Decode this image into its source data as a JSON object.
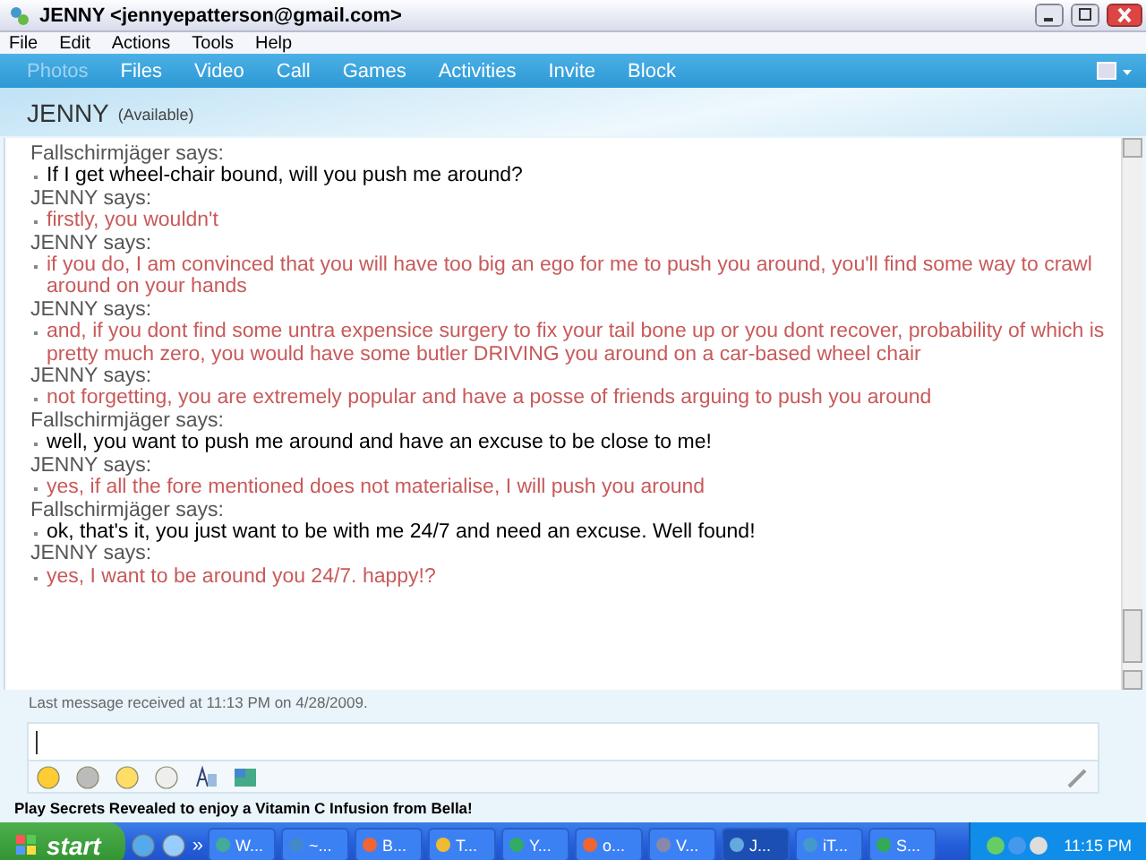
{
  "window": {
    "title": "JENNY <jennyepatterson@gmail.com>"
  },
  "menu": [
    "File",
    "Edit",
    "Actions",
    "Tools",
    "Help"
  ],
  "toolbar": [
    {
      "label": "Photos",
      "disabled": true
    },
    {
      "label": "Files",
      "disabled": false
    },
    {
      "label": "Video",
      "disabled": false
    },
    {
      "label": "Call",
      "disabled": false
    },
    {
      "label": "Games",
      "disabled": false
    },
    {
      "label": "Activities",
      "disabled": false
    },
    {
      "label": "Invite",
      "disabled": false
    },
    {
      "label": "Block",
      "disabled": false
    }
  ],
  "contact": {
    "name": "JENNY",
    "status": "(Available)"
  },
  "messages": [
    {
      "sender": "Fallschirmjäger says:",
      "text": "If I get wheel-chair bound, will you push me around?",
      "color": "#000000"
    },
    {
      "sender": "JENNY says:",
      "text": "firstly, you wouldn't",
      "color": "#c85a5a"
    },
    {
      "sender": "JENNY says:",
      "text": "if you do, I am convinced that you will have too big an ego for me to push you around, you'll find some way to crawl around on your hands",
      "color": "#c85a5a"
    },
    {
      "sender": "JENNY says:",
      "text": "and, if you dont find some untra expensice surgery to fix your tail bone up or you dont recover, probability of which is pretty much zero, you would have some butler DRIVING you around on a car-based wheel chair",
      "color": "#c85a5a"
    },
    {
      "sender": "JENNY says:",
      "text": "not forgetting, you are extremely popular and have a posse of friends arguing to push you around",
      "color": "#c85a5a"
    },
    {
      "sender": "Fallschirmjäger says:",
      "text": "well, you want to push me around and have an excuse to be close to me!",
      "color": "#000000"
    },
    {
      "sender": "JENNY says:",
      "text": "yes, if all the fore mentioned does not materialise, I will push you around",
      "color": "#c85a5a"
    },
    {
      "sender": "Fallschirmjäger says:",
      "text": "ok, that's it, you just want to be with me 24/7 and need an excuse. Well found!",
      "color": "#000000"
    },
    {
      "sender": "JENNY says:",
      "text": "yes, I want to be around you 24/7. happy!?",
      "color": "#c85a5a"
    }
  ],
  "last_message": "Last message received at 11:13 PM on 4/28/2009.",
  "ad": "Play Secrets Revealed to enjoy a Vitamin C Infusion from Bella!",
  "taskbar": {
    "start": "start",
    "more": "»",
    "tasks": [
      {
        "label": "W...",
        "selected": false
      },
      {
        "label": "~...",
        "selected": false
      },
      {
        "label": "B...",
        "selected": false
      },
      {
        "label": "T...",
        "selected": false
      },
      {
        "label": "Y...",
        "selected": false
      },
      {
        "label": "o...",
        "selected": false
      },
      {
        "label": "V...",
        "selected": false
      },
      {
        "label": "J...",
        "selected": true
      },
      {
        "label": "iT...",
        "selected": false
      },
      {
        "label": "S...",
        "selected": false
      }
    ],
    "clock": "11:15 PM"
  }
}
